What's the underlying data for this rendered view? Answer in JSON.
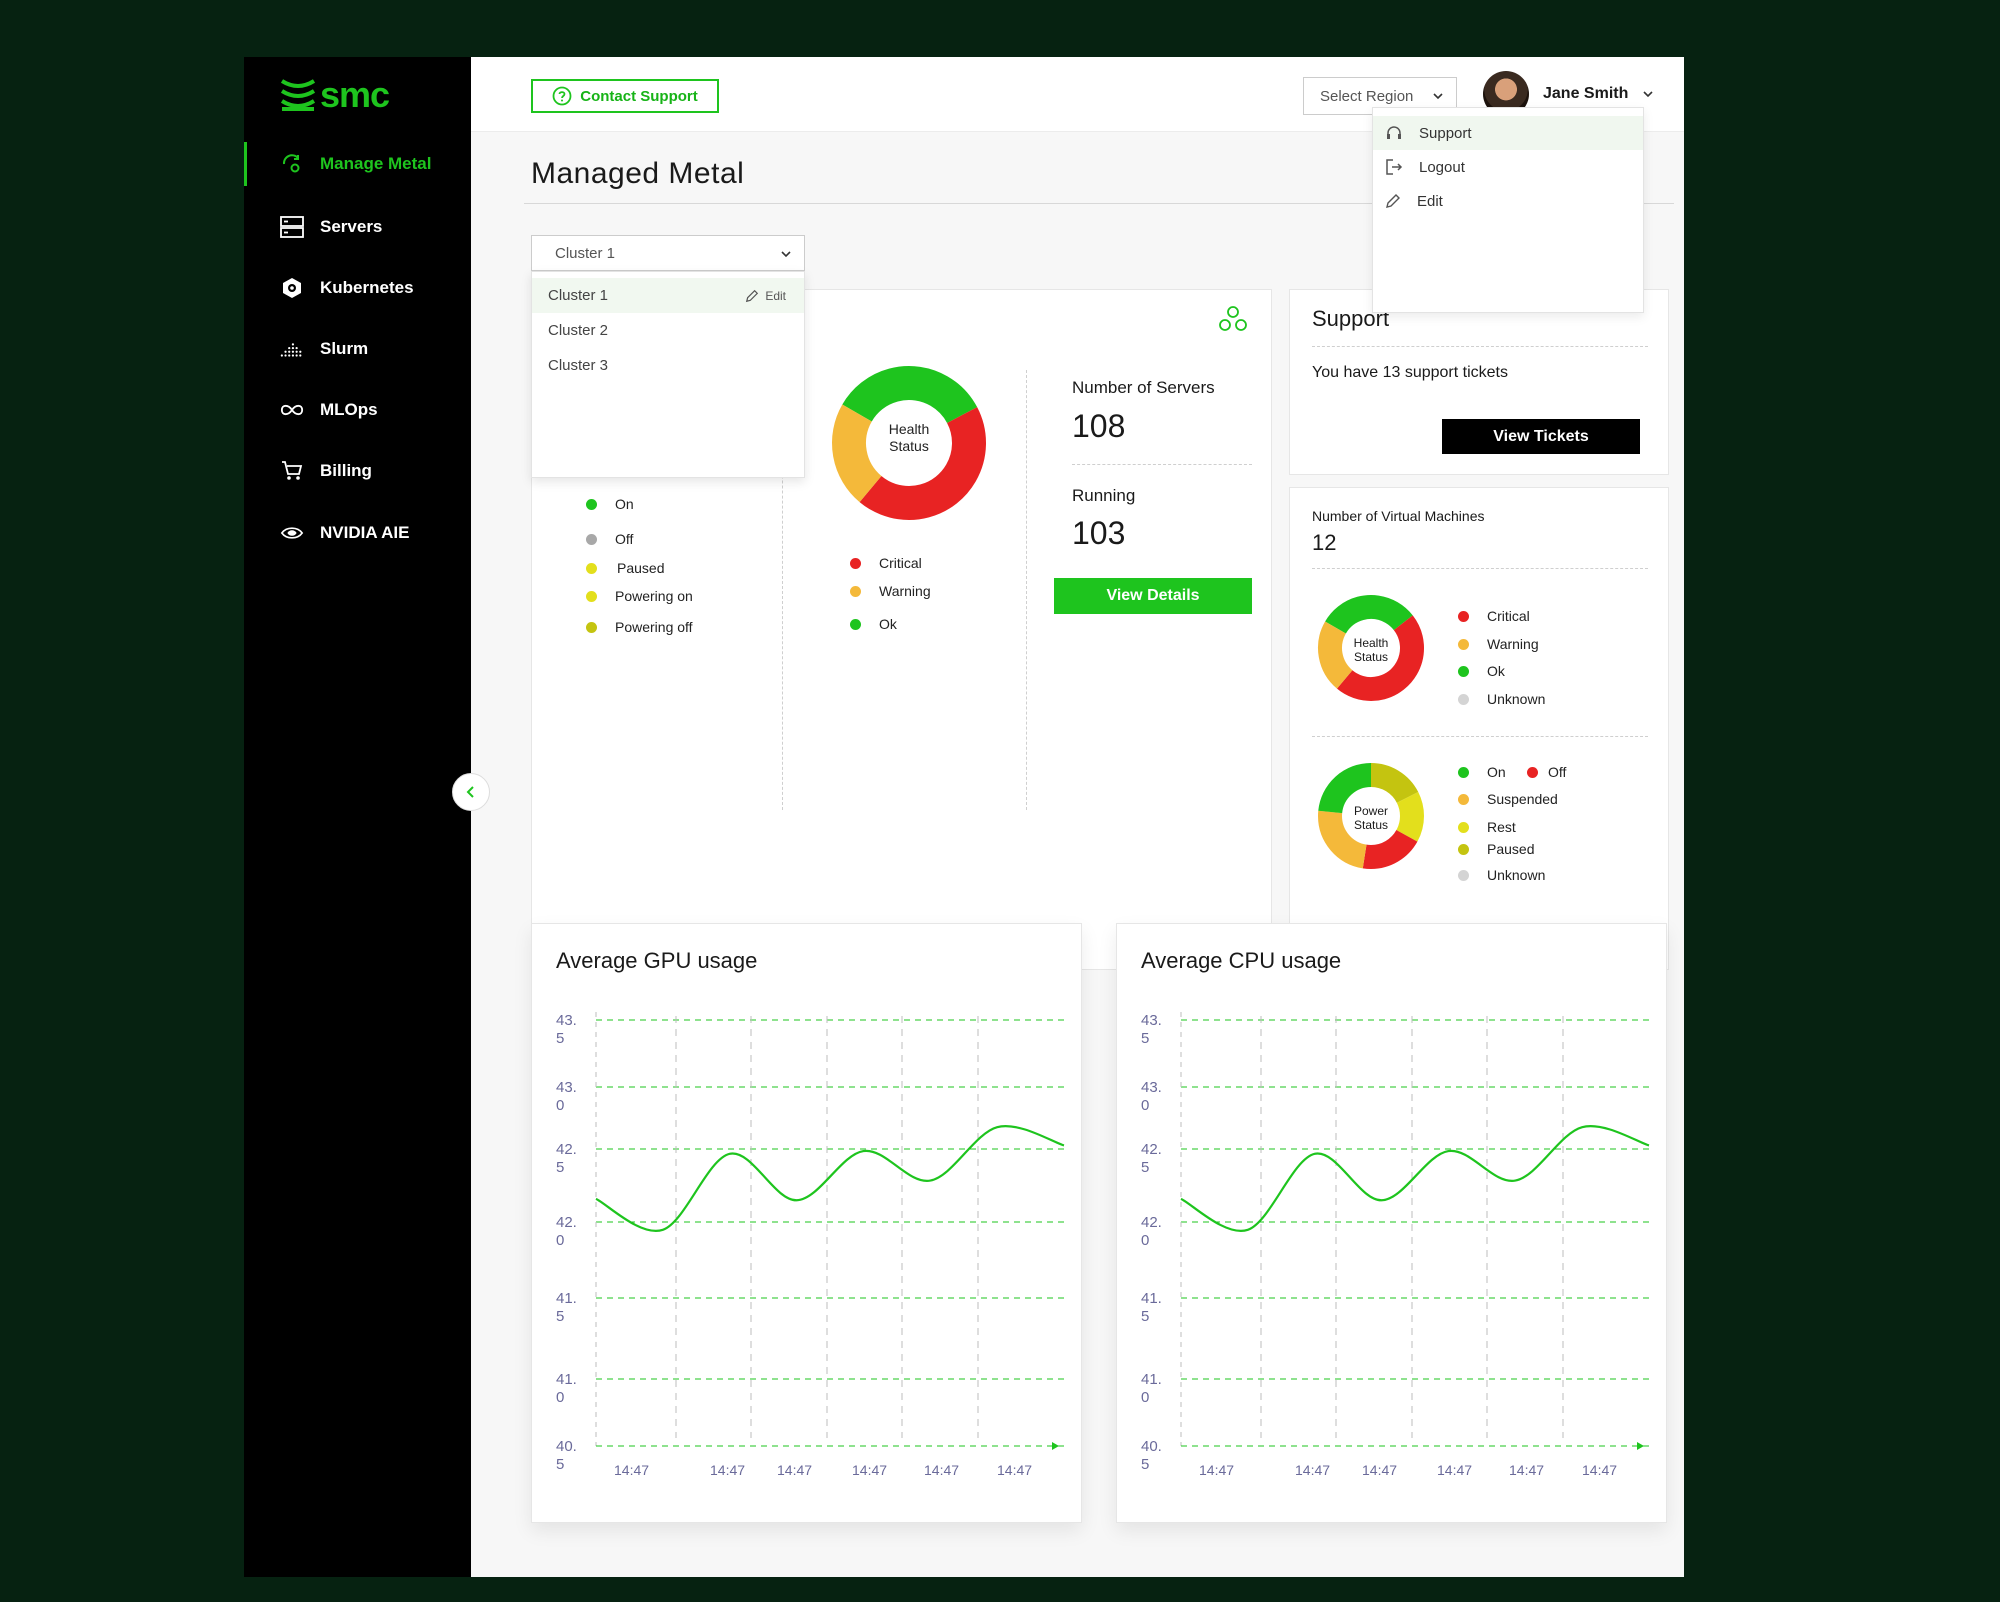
{
  "app": {
    "logo_text": "smc"
  },
  "sidebar": {
    "items": [
      {
        "label": "Manage Metal",
        "icon": "gear-cycle-icon",
        "active": true
      },
      {
        "label": "Servers",
        "icon": "server-icon"
      },
      {
        "label": "Kubernetes",
        "icon": "kubernetes-icon"
      },
      {
        "label": "Slurm",
        "icon": "slurm-icon"
      },
      {
        "label": "MLOps",
        "icon": "infinity-icon"
      },
      {
        "label": "Billing",
        "icon": "cart-icon"
      },
      {
        "label": "NVIDIA AIE",
        "icon": "nvidia-eye-icon"
      }
    ]
  },
  "topbar": {
    "contact_support": "Contact Support",
    "region_placeholder": "Select Region",
    "user_name": "Jane Smith"
  },
  "user_menu": {
    "items": [
      "Support",
      "Logout",
      "Edit"
    ]
  },
  "page": {
    "title": "Managed Metal"
  },
  "cluster": {
    "selected": "Cluster 1",
    "options": [
      "Cluster 1",
      "Cluster 2",
      "Cluster 3"
    ],
    "edit_label": "Edit"
  },
  "overview": {
    "power_legend": [
      "On",
      "Off",
      "Paused",
      "Powering on",
      "Powering off"
    ],
    "health_center": [
      "Health",
      "Status"
    ],
    "health_legend": [
      "Critical",
      "Warning",
      "Ok"
    ],
    "num_servers_label": "Number of Servers",
    "num_servers": "108",
    "running_label": "Running",
    "running": "103",
    "view_details": "View Details"
  },
  "support": {
    "title": "Support",
    "message": "You have 13 support tickets",
    "view_tickets": "View Tickets"
  },
  "vms": {
    "label": "Number of Virtual Machines",
    "count": "12",
    "health_center": [
      "Health",
      "Status"
    ],
    "health_legend": [
      "Critical",
      "Warning",
      "Ok",
      "Unknown"
    ],
    "power_center": [
      "Power",
      "Status"
    ],
    "power_legend": {
      "on": "On",
      "off": "Off",
      "suspended": "Suspended",
      "rest": "Rest",
      "paused": "Paused",
      "unknown": "Unknown"
    }
  },
  "colors": {
    "brand": "#1ec41e",
    "critical": "#e82323",
    "warning": "#f4b93a",
    "ok": "#1ec41e",
    "off": "#a8a8a8",
    "paused": "#e3df1c",
    "powering_off": "#c4c410",
    "unknown": "#d4d4d4"
  },
  "chart_data": [
    {
      "type": "line",
      "title": "Average GPU usage",
      "x": [
        "14:47",
        "14:47",
        "14:47",
        "14:47",
        "14:47",
        "14:47"
      ],
      "ylim": [
        40.5,
        43.5
      ],
      "y_ticks": [
        "43.\n5",
        "43.\n0",
        "42.\n5",
        "42.\n0",
        "41.\n5",
        "41.\n0",
        "40.\n5"
      ],
      "series": [
        {
          "values": [
            42.2,
            41.98,
            42.52,
            42.19,
            42.54,
            42.33,
            42.71,
            42.58
          ]
        }
      ],
      "grid": true
    },
    {
      "type": "line",
      "title": "Average CPU usage",
      "x": [
        "14:47",
        "14:47",
        "14:47",
        "14:47",
        "14:47",
        "14:47"
      ],
      "ylim": [
        40.5,
        43.5
      ],
      "y_ticks": [
        "43.\n5",
        "43.\n0",
        "42.\n5",
        "42.\n0",
        "41.\n5",
        "41.\n0",
        "40.\n5"
      ],
      "series": [
        {
          "values": [
            42.2,
            41.98,
            42.52,
            42.19,
            42.54,
            42.33,
            42.71,
            42.58
          ]
        }
      ],
      "grid": true
    }
  ]
}
